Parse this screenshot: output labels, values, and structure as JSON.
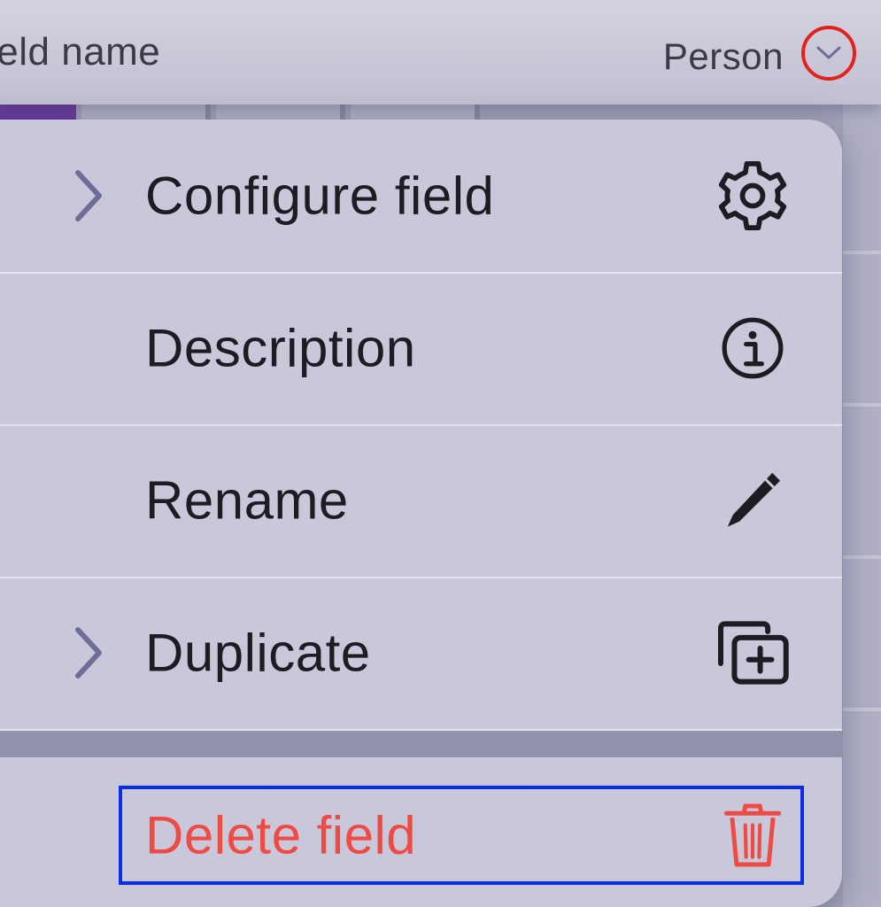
{
  "header": {
    "field_name_label": "ield name",
    "field_type": "Person",
    "dropdown_icon": "chevron-down-icon"
  },
  "menu": {
    "items": [
      {
        "label": "Configure field",
        "has_submenu": true,
        "icon": "gear-icon"
      },
      {
        "label": "Description",
        "has_submenu": false,
        "icon": "info-icon"
      },
      {
        "label": "Rename",
        "has_submenu": false,
        "icon": "pencil-icon"
      },
      {
        "label": "Duplicate",
        "has_submenu": true,
        "icon": "duplicate-icon"
      }
    ],
    "destructive_item": {
      "label": "Delete field",
      "icon": "trash-icon"
    }
  },
  "colors": {
    "menu_background": "#c9c8da",
    "text": "#1c1c22",
    "chevron": "#6f6d96",
    "destructive": "#ef4b45",
    "highlight_circle": "#e3231b",
    "highlight_box": "#0c2de6",
    "accent_purple": "#6b3aa0"
  }
}
